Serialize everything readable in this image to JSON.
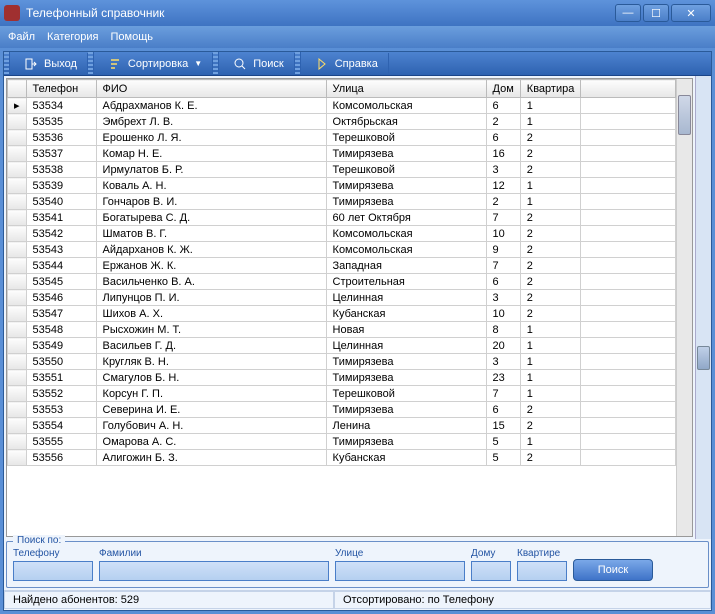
{
  "window": {
    "title": "Телефонный справочник"
  },
  "menubar": {
    "file": "Файл",
    "category": "Категория",
    "help": "Помощь"
  },
  "toolbar": {
    "exit": "Выход",
    "sort": "Сортировка",
    "search": "Поиск",
    "help": "Справка"
  },
  "table": {
    "cols": {
      "phone": "Телефон",
      "fio": "ФИО",
      "street": "Улица",
      "house": "Дом",
      "apt": "Квартира"
    },
    "rows": [
      {
        "phone": "53534",
        "fio": "Абдрахманов К. Е.",
        "street": "Комсомольская",
        "house": "6",
        "apt": "1"
      },
      {
        "phone": "53535",
        "fio": "Эмбрехт Л. В.",
        "street": "Октябрьская",
        "house": "2",
        "apt": "1"
      },
      {
        "phone": "53536",
        "fio": "Ерошенко Л. Я.",
        "street": "Терешковой",
        "house": "6",
        "apt": "2"
      },
      {
        "phone": "53537",
        "fio": "Комар Н. Е.",
        "street": "Тимирязева",
        "house": "16",
        "apt": "2"
      },
      {
        "phone": "53538",
        "fio": "Ирмулатов Б. Р.",
        "street": "Терешковой",
        "house": "3",
        "apt": "2"
      },
      {
        "phone": "53539",
        "fio": "Коваль А. Н.",
        "street": "Тимирязева",
        "house": "12",
        "apt": "1"
      },
      {
        "phone": "53540",
        "fio": "Гончаров В. И.",
        "street": "Тимирязева",
        "house": "2",
        "apt": "1"
      },
      {
        "phone": "53541",
        "fio": "Богатырева С. Д.",
        "street": "60 лет Октября",
        "house": "7",
        "apt": "2"
      },
      {
        "phone": "53542",
        "fio": "Шматов В. Г.",
        "street": "Комсомольская",
        "house": "10",
        "apt": "2"
      },
      {
        "phone": "53543",
        "fio": "Айдарханов К. Ж.",
        "street": "Комсомольская",
        "house": "9",
        "apt": "2"
      },
      {
        "phone": "53544",
        "fio": "Ержанов Ж. К.",
        "street": "Западная",
        "house": "7",
        "apt": "2"
      },
      {
        "phone": "53545",
        "fio": "Васильченко В. А.",
        "street": "Строительная",
        "house": "6",
        "apt": "2"
      },
      {
        "phone": "53546",
        "fio": "Липунцов П. И.",
        "street": "Целинная",
        "house": "3",
        "apt": "2"
      },
      {
        "phone": "53547",
        "fio": "Шихов А. Х.",
        "street": "Кубанская",
        "house": "10",
        "apt": "2"
      },
      {
        "phone": "53548",
        "fio": "Рысхожин М. Т.",
        "street": "Новая",
        "house": "8",
        "apt": "1"
      },
      {
        "phone": "53549",
        "fio": "Васильев Г. Д.",
        "street": "Целинная",
        "house": "20",
        "apt": "1"
      },
      {
        "phone": "53550",
        "fio": "Кругляк В. Н.",
        "street": "Тимирязева",
        "house": "3",
        "apt": "1"
      },
      {
        "phone": "53551",
        "fio": "Смагулов Б. Н.",
        "street": "Тимирязева",
        "house": "23",
        "apt": "1"
      },
      {
        "phone": "53552",
        "fio": "Корсун Г. П.",
        "street": "Терешковой",
        "house": "7",
        "apt": "1"
      },
      {
        "phone": "53553",
        "fio": "Северина И. Е.",
        "street": "Тимирязева",
        "house": "6",
        "apt": "2"
      },
      {
        "phone": "53554",
        "fio": "Голубович А. Н.",
        "street": "Ленина",
        "house": "15",
        "apt": "2"
      },
      {
        "phone": "53555",
        "fio": "Омарова А. С.",
        "street": "Тимирязева",
        "house": "5",
        "apt": "1"
      },
      {
        "phone": "53556",
        "fio": "Алигожин Б. З.",
        "street": "Кубанская",
        "house": "5",
        "apt": "2"
      }
    ]
  },
  "search": {
    "legend": "Поиск по:",
    "phone_label": "Телефону",
    "surname_label": "Фамилии",
    "street_label": "Улице",
    "house_label": "Дому",
    "apt_label": "Квартире",
    "button": "Поиск"
  },
  "status": {
    "found": "Найдено абонентов: 529",
    "sorted": "Отсортировано: по Телефону"
  }
}
